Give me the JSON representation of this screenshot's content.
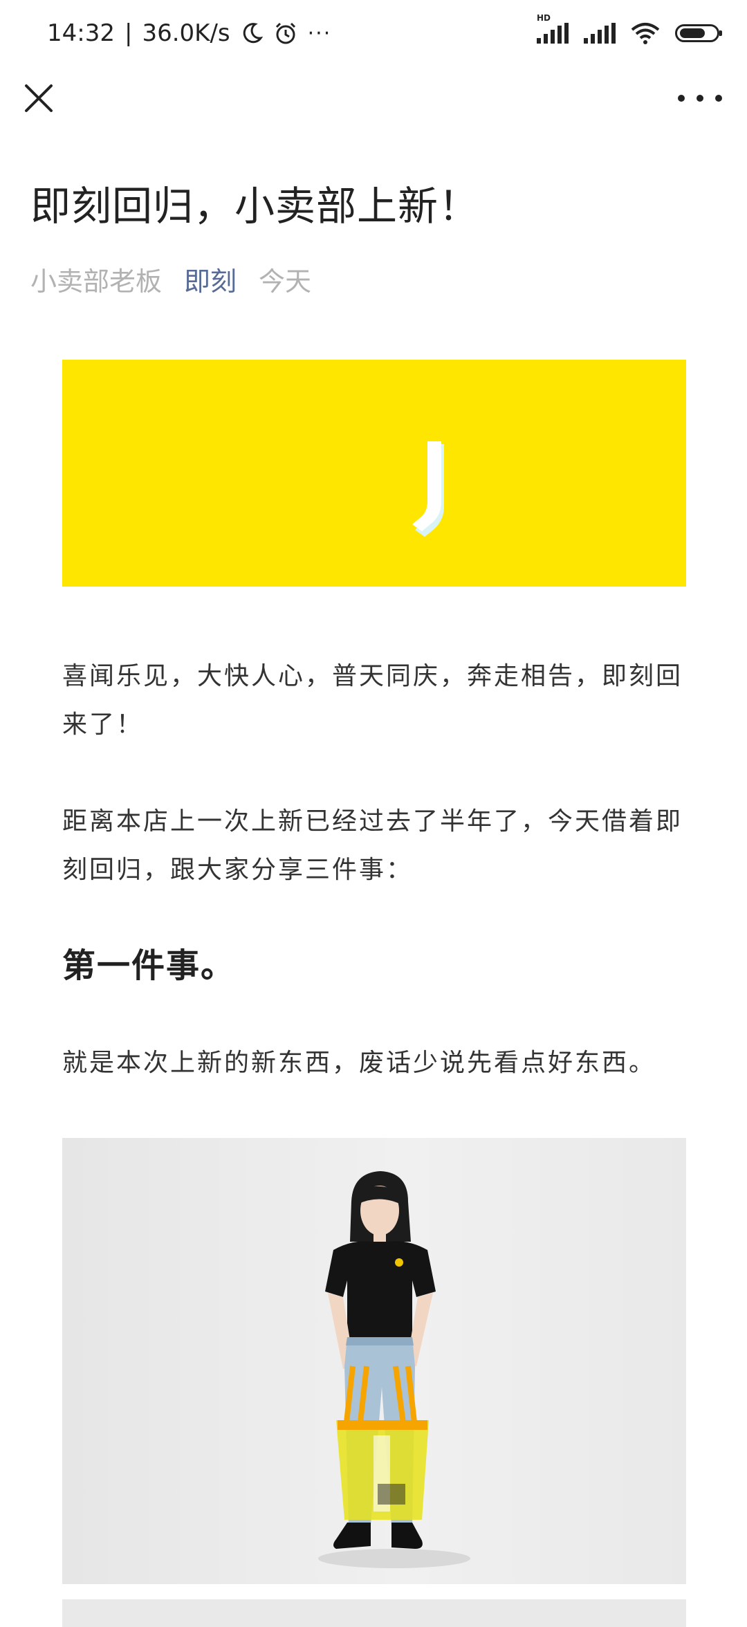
{
  "status_bar": {
    "time": "14:32",
    "separator": "|",
    "network_speed": "36.0K/s",
    "overflow_dots": "···",
    "hd_label": "HD"
  },
  "nav": {
    "close_icon": "close-icon",
    "more_icon": "more-icon"
  },
  "article": {
    "title": "即刻回归，小卖部上新！",
    "author": "小卖部老板",
    "account": "即刻",
    "date": "今天",
    "banner_color": "#ffe600",
    "paragraphs": [
      "喜闻乐见，大快人心，普天同庆，奔走相告，即刻回来了！",
      "距离本店上一次上新已经过去了半年了，今天借着即刻回归，跟大家分享三件事："
    ],
    "heading": "第一件事。",
    "paragraph3": "就是本次上新的新东西，废话少说先看点好东西。"
  },
  "colors": {
    "link": "#576b95",
    "muted": "#b2b2b2",
    "accent_yellow": "#ffe600"
  }
}
